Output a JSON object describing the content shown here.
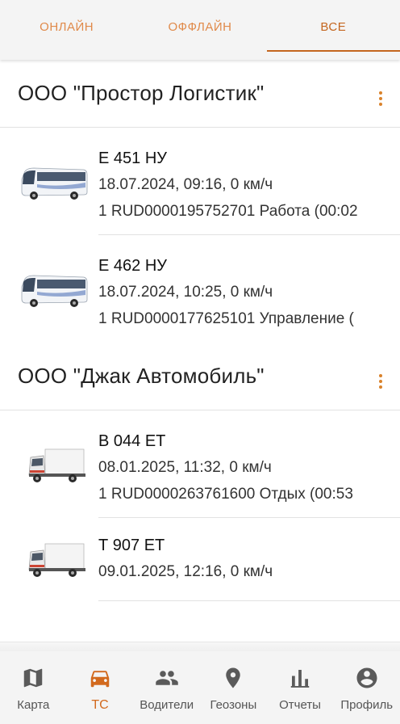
{
  "tabs": [
    {
      "label": "ОНЛАЙН"
    },
    {
      "label": "ОФФЛАЙН"
    },
    {
      "label": "ВСЕ"
    }
  ],
  "active_tab": "ВСЕ",
  "accent_color": "#c4661f",
  "groups": [
    {
      "name": "ООО \"Простор Логистик\"",
      "menu_icon": "more-vertical-icon",
      "vehicles": [
        {
          "plate": "Е 451 НУ",
          "status_line": "18.07.2024, 09:16, 0 км/ч",
          "driver_line": "1 RUD0000195752701 Работа (00:02",
          "image": "bus-icon"
        },
        {
          "plate": "Е 462 НУ",
          "status_line": "18.07.2024, 10:25, 0 км/ч",
          "driver_line": "1 RUD0000177625101 Управление (",
          "image": "bus-icon"
        }
      ]
    },
    {
      "name": "ООО \"Джак Автомобиль\"",
      "menu_icon": "more-vertical-icon",
      "vehicles": [
        {
          "plate": "В 044 ЕТ",
          "status_line": "08.01.2025, 11:32, 0 км/ч",
          "driver_line": "1 RUD0000263761600 Отдых (00:53",
          "image": "truck-icon"
        },
        {
          "plate": "Т 907 ЕТ",
          "status_line": "09.01.2025, 12:16, 0 км/ч",
          "image": "truck-icon"
        }
      ]
    }
  ],
  "nav": [
    {
      "label": "Карта",
      "icon": "map-icon"
    },
    {
      "label": "ТС",
      "icon": "car-icon"
    },
    {
      "label": "Водители",
      "icon": "people-icon"
    },
    {
      "label": "Геозоны",
      "icon": "location-pin-icon"
    },
    {
      "label": "Отчеты",
      "icon": "bar-chart-icon"
    },
    {
      "label": "Профиль",
      "icon": "account-circle-icon"
    }
  ],
  "active_nav": "ТС"
}
